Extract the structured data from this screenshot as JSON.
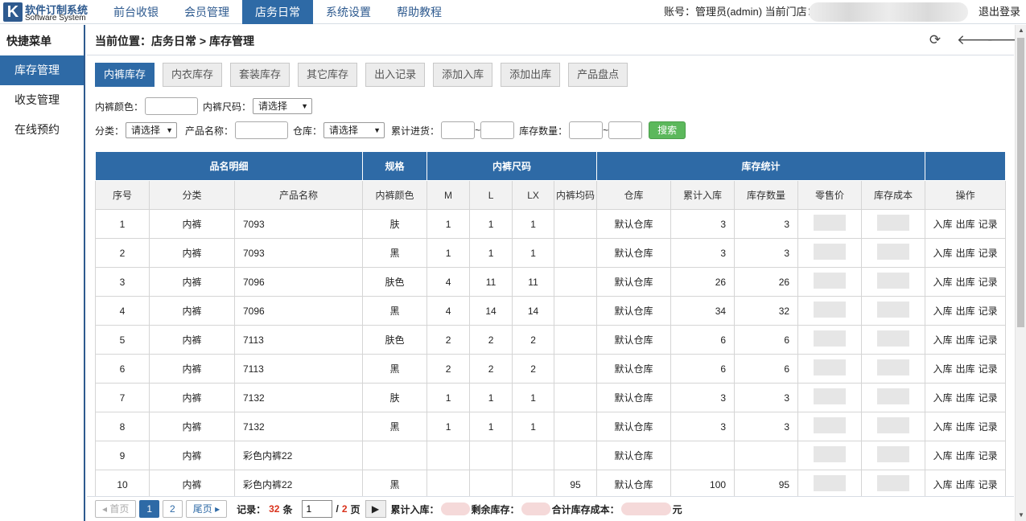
{
  "logo": {
    "mark": "K",
    "title": "软件订制系统",
    "subtitle": "Software System"
  },
  "nav": [
    {
      "label": "前台收银"
    },
    {
      "label": "会员管理"
    },
    {
      "label": "店务日常"
    },
    {
      "label": "系统设置"
    },
    {
      "label": "帮助教程"
    }
  ],
  "account": "账号：管理员(admin)   当前门店：",
  "logout": "退出登录",
  "sidebar": {
    "title": "快捷菜单",
    "items": [
      {
        "label": "库存管理"
      },
      {
        "label": "收支管理"
      },
      {
        "label": "在线预约"
      }
    ]
  },
  "breadcrumb": "当前位置：店务日常 > 库存管理",
  "icons": {
    "refresh": "⟳",
    "back": "🡐",
    "forward": "🡒"
  },
  "tabs": [
    {
      "label": "内裤库存"
    },
    {
      "label": "内衣库存"
    },
    {
      "label": "套装库存"
    },
    {
      "label": "其它库存"
    },
    {
      "label": "出入记录"
    },
    {
      "label": "添加入库"
    },
    {
      "label": "添加出库"
    },
    {
      "label": "产品盘点"
    }
  ],
  "filters": {
    "color_label": "内裤颜色：",
    "size_label": "内裤尺码：",
    "size_value": "请选择",
    "category_label": "分类：",
    "category_value": "请选择",
    "name_label": "产品名称：",
    "warehouse_label": "仓库：",
    "warehouse_value": "请选择",
    "purchase_label": "累计进货：",
    "tilde": "~",
    "stock_label": "库存数量：",
    "search_label": "搜索"
  },
  "table": {
    "groups": [
      "品名明细",
      "规格",
      "内裤尺码",
      "库存统计",
      ""
    ],
    "columns": [
      "序号",
      "分类",
      "产品名称",
      "内裤颜色",
      "M",
      "L",
      "LX",
      "内裤均码",
      "仓库",
      "累计入库",
      "库存数量",
      "零售价",
      "库存成本",
      "操作"
    ],
    "ops": [
      "入库",
      "出库",
      "记录"
    ],
    "rows": [
      [
        "1",
        "内裤",
        "7093",
        "肤",
        "1",
        "1",
        "1",
        "",
        "默认仓库",
        "3",
        "3"
      ],
      [
        "2",
        "内裤",
        "7093",
        "黑",
        "1",
        "1",
        "1",
        "",
        "默认仓库",
        "3",
        "3"
      ],
      [
        "3",
        "内裤",
        "7096",
        "肤色",
        "4",
        "11",
        "11",
        "",
        "默认仓库",
        "26",
        "26"
      ],
      [
        "4",
        "内裤",
        "7096",
        "黑",
        "4",
        "14",
        "14",
        "",
        "默认仓库",
        "34",
        "32"
      ],
      [
        "5",
        "内裤",
        "7113",
        "肤色",
        "2",
        "2",
        "2",
        "",
        "默认仓库",
        "6",
        "6"
      ],
      [
        "6",
        "内裤",
        "7113",
        "黑",
        "2",
        "2",
        "2",
        "",
        "默认仓库",
        "6",
        "6"
      ],
      [
        "7",
        "内裤",
        "7132",
        "肤",
        "1",
        "1",
        "1",
        "",
        "默认仓库",
        "3",
        "3"
      ],
      [
        "8",
        "内裤",
        "7132",
        "黑",
        "1",
        "1",
        "1",
        "",
        "默认仓库",
        "3",
        "3"
      ],
      [
        "9",
        "内裤",
        "彩色内裤22",
        "",
        "",
        "",
        "",
        "",
        "默认仓库",
        "",
        ""
      ],
      [
        "10",
        "内裤",
        "彩色内裤22",
        "黑",
        "",
        "",
        "",
        "95",
        "默认仓库",
        "100",
        "95"
      ]
    ]
  },
  "footer": {
    "first": "◂ 首页",
    "page1": "1",
    "page2": "2",
    "last": "尾页 ▸",
    "records_label": "记录：",
    "records_count": "32",
    "records_unit": "条",
    "page_input": "1",
    "slash": "/",
    "total_pages": "2",
    "pages_unit": "页",
    "go": "▶",
    "total_in_label": "累计入库：",
    "remain_label": "剩余库存：",
    "cost_label": "合计库存成本：",
    "yuan": "元"
  }
}
